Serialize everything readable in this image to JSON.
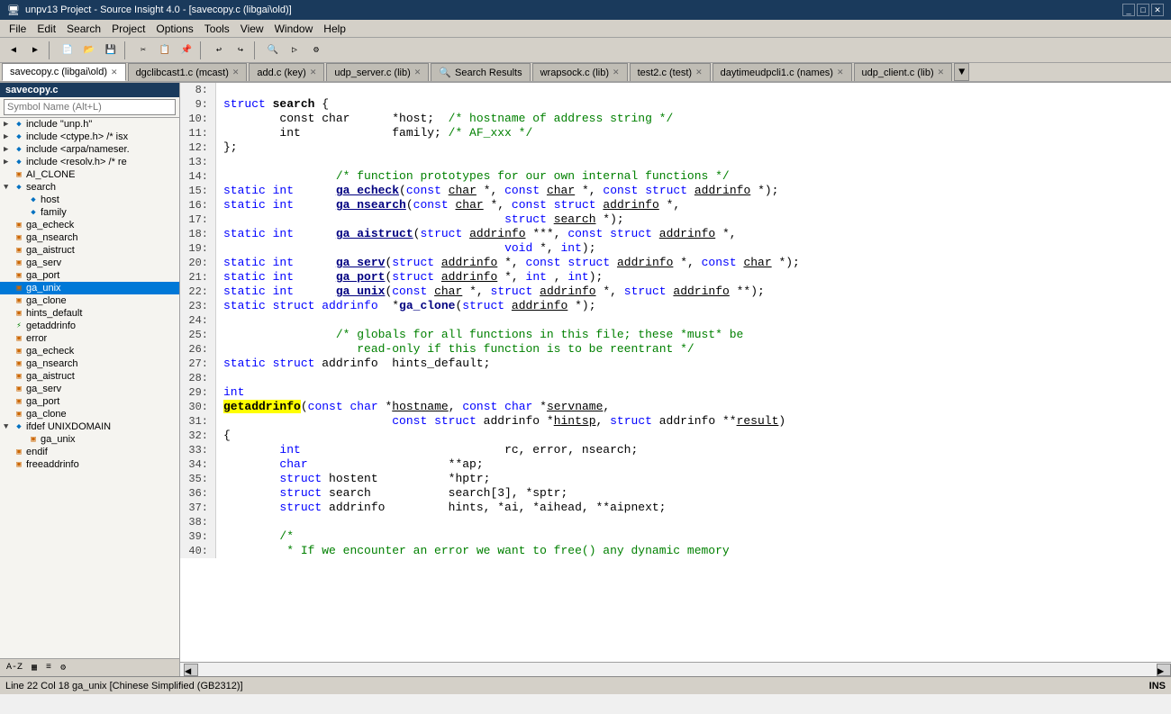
{
  "titlebar": {
    "text": "unpv13 Project - Source Insight 4.0 - [savecopy.c (libgai\\old)]",
    "icon": "📄"
  },
  "menubar": {
    "items": [
      "File",
      "Edit",
      "Search",
      "Project",
      "Options",
      "Tools",
      "View",
      "Window",
      "Help"
    ]
  },
  "tabs": [
    {
      "label": "savecopy.c (libgai\\old)",
      "active": true,
      "closeable": true
    },
    {
      "label": "dgclibcast1.c (mcast)",
      "active": false,
      "closeable": true
    },
    {
      "label": "add.c (key)",
      "active": false,
      "closeable": true
    },
    {
      "label": "udp_server.c (lib)",
      "active": false,
      "closeable": true
    },
    {
      "label": "Search Results",
      "active": false,
      "closeable": false,
      "icon": "🔍"
    },
    {
      "label": "wrapsock.c (lib)",
      "active": false,
      "closeable": true
    },
    {
      "label": "test2.c (test)",
      "active": false,
      "closeable": true
    },
    {
      "label": "daytimeudpcli1.c (names)",
      "active": false,
      "closeable": true
    },
    {
      "label": "udp_client.c (lib)",
      "active": false,
      "closeable": true
    }
  ],
  "sidebar": {
    "title": "savecopy.c",
    "symbol_placeholder": "Symbol Name (Alt+L)",
    "tree": [
      {
        "indent": 0,
        "type": "expand",
        "expand": "▶",
        "icon": "◆",
        "label": "include \"unp.h\""
      },
      {
        "indent": 0,
        "type": "expand",
        "expand": "▶",
        "icon": "◆",
        "label": "include <ctype.h> /* isx"
      },
      {
        "indent": 0,
        "type": "expand",
        "expand": "▶",
        "icon": "◆",
        "label": "include <arpa/nameser."
      },
      {
        "indent": 0,
        "type": "expand",
        "expand": "▶",
        "icon": "◆",
        "label": "include <resolv.h> /* re"
      },
      {
        "indent": 0,
        "type": "leaf",
        "icon": "▣",
        "label": "AI_CLONE"
      },
      {
        "indent": 0,
        "type": "open",
        "expand": "▼",
        "icon": "◆",
        "label": "search",
        "selected": false
      },
      {
        "indent": 1,
        "type": "leaf",
        "icon": "◆",
        "label": "host"
      },
      {
        "indent": 1,
        "type": "leaf",
        "icon": "◆",
        "label": "family"
      },
      {
        "indent": 0,
        "type": "leaf",
        "icon": "▣",
        "label": "ga_echeck"
      },
      {
        "indent": 0,
        "type": "leaf",
        "icon": "▣",
        "label": "ga_nsearch"
      },
      {
        "indent": 0,
        "type": "leaf",
        "icon": "▣",
        "label": "ga_aistruct"
      },
      {
        "indent": 0,
        "type": "leaf",
        "icon": "▣",
        "label": "ga_serv"
      },
      {
        "indent": 0,
        "type": "leaf",
        "icon": "▣",
        "label": "ga_port"
      },
      {
        "indent": 0,
        "type": "leaf",
        "icon": "▣",
        "label": "ga_unix",
        "selected": true
      },
      {
        "indent": 0,
        "type": "leaf",
        "icon": "▣",
        "label": "ga_clone"
      },
      {
        "indent": 0,
        "type": "leaf",
        "icon": "▣",
        "label": "hints_default"
      },
      {
        "indent": 0,
        "type": "leaf",
        "icon": "fn",
        "label": "getaddrinfo"
      },
      {
        "indent": 0,
        "type": "leaf",
        "icon": "▣",
        "label": "error"
      },
      {
        "indent": 0,
        "type": "leaf",
        "icon": "▣",
        "label": "ga_echeck"
      },
      {
        "indent": 0,
        "type": "leaf",
        "icon": "▣",
        "label": "ga_nsearch"
      },
      {
        "indent": 0,
        "type": "leaf",
        "icon": "▣",
        "label": "ga_aistruct"
      },
      {
        "indent": 0,
        "type": "leaf",
        "icon": "▣",
        "label": "ga_serv"
      },
      {
        "indent": 0,
        "type": "leaf",
        "icon": "▣",
        "label": "ga_port"
      },
      {
        "indent": 0,
        "type": "leaf",
        "icon": "▣",
        "label": "ga_clone"
      },
      {
        "indent": 0,
        "type": "expand",
        "expand": "▼",
        "icon": "◆",
        "label": "ifdef UNIXDOMAIN"
      },
      {
        "indent": 1,
        "type": "leaf",
        "icon": "▣",
        "label": "ga_unix"
      },
      {
        "indent": 0,
        "type": "leaf",
        "icon": "▣",
        "label": "endif"
      },
      {
        "indent": 0,
        "type": "leaf",
        "icon": "▣",
        "label": "freeaddrinfo"
      }
    ]
  },
  "code": {
    "lines": [
      {
        "num": "8:",
        "content": ""
      },
      {
        "num": "9:",
        "content": "struct_search_{"
      },
      {
        "num": "10:",
        "content": "\tconst char\t*host;\t/* hostname of address string */"
      },
      {
        "num": "11:",
        "content": "\tint\t\tfamily;\t/* AF_xxx */"
      },
      {
        "num": "12:",
        "content": "};"
      },
      {
        "num": "13:",
        "content": ""
      },
      {
        "num": "14:",
        "content": "\t\t/* function prototypes for our own internal functions */"
      },
      {
        "num": "15:",
        "content": "static int\tga_echeck(const char *, const char *, const struct addrinfo *);"
      },
      {
        "num": "16:",
        "content": "static int\tga_nsearch(const char *, const struct addrinfo *,"
      },
      {
        "num": "17:",
        "content": "\t\t\t\t\tstruct search *);"
      },
      {
        "num": "18:",
        "content": "static int\tga_aistruct(struct addrinfo ***, const struct addrinfo *,"
      },
      {
        "num": "19:",
        "content": "\t\t\t\t\tvoid *, int);"
      },
      {
        "num": "20:",
        "content": "static int\tga_serv(struct addrinfo *, const struct addrinfo *, const char *);"
      },
      {
        "num": "21:",
        "content": "static int\tga_port(struct addrinfo *, int , int);"
      },
      {
        "num": "22:",
        "content": "static int\tga_unix(const char *, struct addrinfo *, struct addrinfo **);"
      },
      {
        "num": "23:",
        "content": "static struct addrinfo\t*ga_clone(struct addrinfo *);"
      },
      {
        "num": "24:",
        "content": ""
      },
      {
        "num": "25:",
        "content": "\t\t/* globals for all functions in this file; these *must* be"
      },
      {
        "num": "26:",
        "content": "\t\t   read-only if this function is to be reentrant */"
      },
      {
        "num": "27:",
        "content": "static struct addrinfo  hints_default;"
      },
      {
        "num": "28:",
        "content": ""
      },
      {
        "num": "29:",
        "content": "int"
      },
      {
        "num": "30:",
        "content": "getaddrinfo(const char *hostname, const char *servname,"
      },
      {
        "num": "31:",
        "content": "\t\t\tconst struct addrinfo *hintsp, struct addrinfo **result)"
      },
      {
        "num": "32:",
        "content": "{"
      },
      {
        "num": "33:",
        "content": "\tint\t\t\t\trc, error, nsearch;"
      },
      {
        "num": "34:",
        "content": "\tchar\t\t\t**ap;"
      },
      {
        "num": "35:",
        "content": "\tstruct hostent\t\t*hptr;"
      },
      {
        "num": "36:",
        "content": "\tstruct search\t\tsearch[3], *sptr;"
      },
      {
        "num": "37:",
        "content": "\tstruct addrinfo\t\thints, *ai, *aihead, **aipnext;"
      },
      {
        "num": "38:",
        "content": ""
      },
      {
        "num": "39:",
        "content": "\t/*"
      },
      {
        "num": "40:",
        "content": "\t * If we encounter an error we want to free() any dynamic memory"
      }
    ]
  },
  "status": {
    "left": "Line 22  Col 18   ga_unix [Chinese Simplified (GB2312)]",
    "right": "INS"
  }
}
